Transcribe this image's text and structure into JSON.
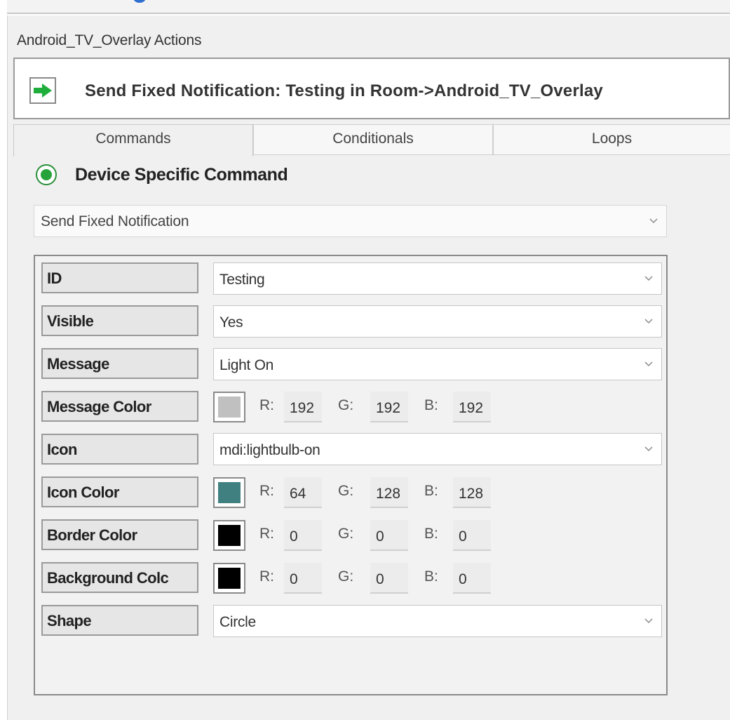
{
  "panel": {
    "title": "Android_TV_Overlay Actions",
    "action_summary": "Send Fixed Notification:  Testing in Room->Android_TV_Overlay"
  },
  "tabs": [
    {
      "label": "Commands",
      "active": true
    },
    {
      "label": "Conditionals",
      "active": false
    },
    {
      "label": "Loops",
      "active": false
    }
  ],
  "command_type": {
    "label": "Device Specific Command",
    "selected": true
  },
  "command_select": {
    "value": "Send Fixed Notification"
  },
  "params": {
    "id": {
      "label": "ID",
      "value": "Testing"
    },
    "visible": {
      "label": "Visible",
      "value": "Yes"
    },
    "message": {
      "label": "Message",
      "value": "Light On"
    },
    "message_color": {
      "label": "Message Color",
      "swatch": "#c0c0c0",
      "r": "192",
      "g": "192",
      "b": "192"
    },
    "icon": {
      "label": "Icon",
      "value": "mdi:lightbulb-on"
    },
    "icon_color": {
      "label": "Icon Color",
      "swatch": "#408080",
      "r": "64",
      "g": "128",
      "b": "128"
    },
    "border_color": {
      "label": "Border Color",
      "swatch": "#000000",
      "r": "0",
      "g": "0",
      "b": "0"
    },
    "background_color": {
      "label": "Background Colc",
      "swatch": "#000000",
      "r": "0",
      "g": "0",
      "b": "0"
    },
    "shape": {
      "label": "Shape",
      "value": "Circle"
    }
  },
  "rgb_labels": {
    "r": "R:",
    "g": "G:",
    "b": "B:"
  },
  "colors": {
    "go_arrow": "#1fae3c",
    "radio_accent": "#26a33a"
  }
}
